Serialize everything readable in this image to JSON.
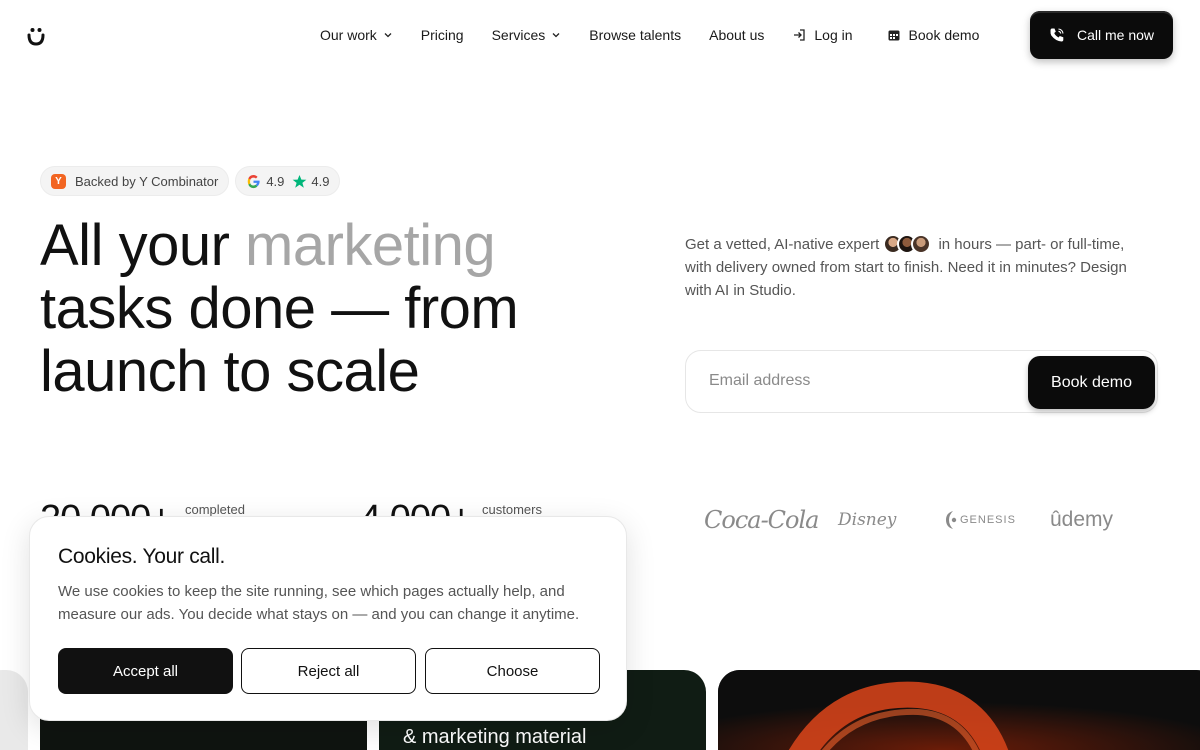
{
  "nav": {
    "items": [
      {
        "label": "Our work"
      },
      {
        "label": "Pricing"
      },
      {
        "label": "Services"
      },
      {
        "label": "Browse talents"
      },
      {
        "label": "About us"
      },
      {
        "label": "Log in"
      },
      {
        "label": "Book demo"
      }
    ],
    "cta_label": "Call me now"
  },
  "badges": {
    "yc_letter": "Y",
    "yc_label": "Backed by Y Combinator",
    "google_rating": "4.9",
    "star_rating": "4.9"
  },
  "hero": {
    "headline_part1": "All your ",
    "headline_highlight": "marketing",
    "headline_part2": "tasks done — from launch to scale",
    "desc_part1": "Get a vetted, AI-native expert",
    "desc_part2": " in hours — part- or full-time, with delivery owned from start to finish. Need it in minutes? Design with AI in Studio.",
    "email_placeholder": "Email address",
    "submit_label": "Book demo"
  },
  "stats": [
    {
      "value": "20,000+",
      "label": "completed"
    },
    {
      "value": "4,000+",
      "label": "customers"
    }
  ],
  "logos": [
    "Coca-Cola",
    "Disney",
    "GENESIS",
    "ûdemy"
  ],
  "cards": {
    "card_c_text": "& marketing material"
  },
  "cookie": {
    "title": "Cookies. Your call.",
    "text": "We use cookies to keep the site running, see which pages actually help, and measure our ads. You decide what stays on — and you can change it anytime.",
    "accept_label": "Accept all",
    "reject_label": "Reject all",
    "choose_label": "Choose"
  },
  "colors": {
    "primary": "#0b0b0b",
    "muted_headline": "#a6a6a6",
    "yc_orange": "#f26522",
    "star_green": "#00b67a"
  }
}
